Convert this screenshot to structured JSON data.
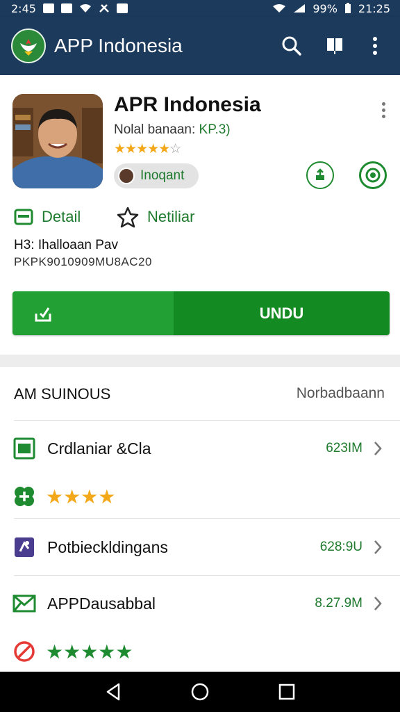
{
  "status_bar": {
    "time_left": "2:45",
    "battery": "99%",
    "time_right": "21:25"
  },
  "app_bar": {
    "title": "APP Indonesia",
    "icons": [
      "search-icon",
      "book-icon",
      "more-vert-icon"
    ]
  },
  "app_header": {
    "name": "APR Indonesia",
    "subtitle_prefix": "Nolal banaan: ",
    "subtitle_value": "KP.3)",
    "rating_filled": "★★★★★",
    "rating_empty": "☆",
    "chip_label": "Inoqant"
  },
  "links": {
    "detail": "Detail",
    "wishlist": "Netiliar"
  },
  "meta": {
    "line1": "H3: Ihalloaan Pav",
    "line2": "PKPK9010909MU8AC20"
  },
  "download": {
    "label": "UNDU"
  },
  "section": {
    "title": "AM SUINOUS",
    "link": "Norbadbaann"
  },
  "items": [
    {
      "label": "Crdlaniar &Cla",
      "value": "623IM"
    },
    {
      "label": "Potbieckldingans",
      "value": "628:9U"
    },
    {
      "label": "APPDausabbal",
      "value": "8.27.9M"
    }
  ],
  "ratings": {
    "first": "★★★★",
    "second": "★★★★★"
  },
  "colors": {
    "app_bar": "#1c3a5c",
    "accent_green": "#138a22",
    "link_green": "#1e7a2d",
    "star_gold": "#f3a81a"
  }
}
